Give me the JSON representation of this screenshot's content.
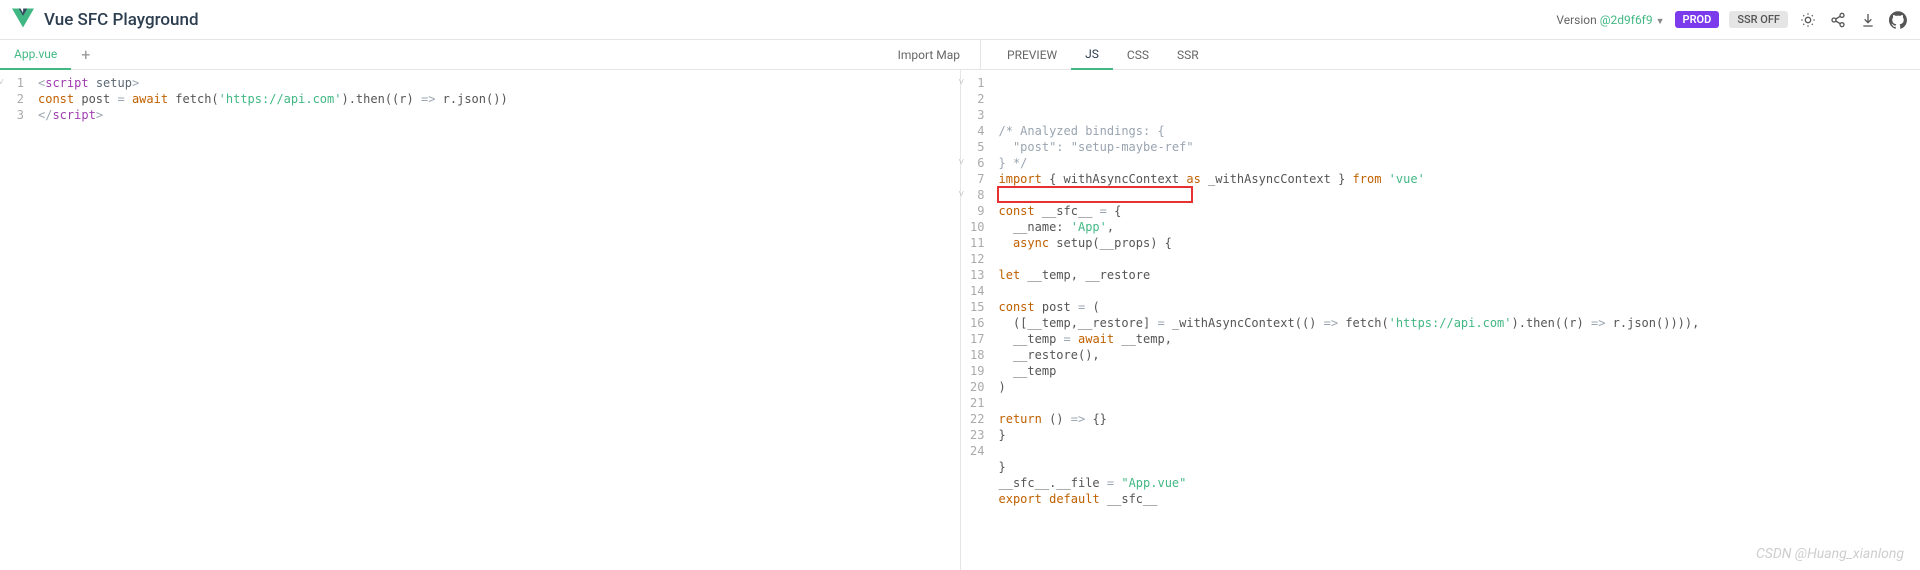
{
  "header": {
    "title": "Vue SFC Playground",
    "version_label": "Version",
    "version_hash": "@2d9f6f9",
    "prod_label": "PROD",
    "ssr_label": "SSR OFF"
  },
  "left_tabs": {
    "file": "App.vue",
    "import_map": "Import Map"
  },
  "right_tabs": {
    "preview": "PREVIEW",
    "js": "JS",
    "css": "CSS",
    "ssr": "SSR",
    "active": "JS"
  },
  "left_code": {
    "lines": [
      {
        "n": 1,
        "fold": true,
        "html": "<span class='op'>&lt;</span><span class='hl'>script</span> <span class='nm'>setup</span><span class='op'>&gt;</span>"
      },
      {
        "n": 2,
        "html": "<span class='kw'>const</span> post <span class='op'>=</span> <span class='kw'>await</span> fetch(<span class='str'>'https://api.com'</span>).then((r) <span class='op'>=&gt;</span> r.json())"
      },
      {
        "n": 3,
        "html": "<span class='op'>&lt;/</span><span class='hl'>script</span><span class='op'>&gt;</span>"
      }
    ]
  },
  "right_code": {
    "highlight_line": 8,
    "lines": [
      {
        "n": 1,
        "fold": true,
        "html": "<span class='cm'>/* Analyzed bindings: {</span>"
      },
      {
        "n": 2,
        "html": "<span class='cm'>  \"post\": \"setup-maybe-ref\"</span>"
      },
      {
        "n": 3,
        "html": "<span class='cm'>} */</span>"
      },
      {
        "n": 4,
        "html": "<span class='kw'>import</span> { withAsyncContext <span class='kw'>as</span> _withAsyncContext } <span class='kw'>from</span> <span class='str'>'vue'</span>"
      },
      {
        "n": 5,
        "html": ""
      },
      {
        "n": 6,
        "fold": true,
        "html": "<span class='kw'>const</span> __sfc__ <span class='op'>=</span> {"
      },
      {
        "n": 7,
        "html": "  __name: <span class='str'>'App'</span>,"
      },
      {
        "n": 8,
        "fold": true,
        "html": "  <span class='kw'>async</span> setup(__props) {"
      },
      {
        "n": 9,
        "html": ""
      },
      {
        "n": 10,
        "html": "<span class='kw'>let</span> __temp, __restore"
      },
      {
        "n": 11,
        "html": ""
      },
      {
        "n": 12,
        "html": "<span class='kw'>const</span> post <span class='op'>=</span> ("
      },
      {
        "n": 13,
        "html": "  ([__temp,__restore] <span class='op'>=</span> _withAsyncContext(() <span class='op'>=&gt;</span> fetch(<span class='str'>'https://api.com'</span>).then((r) <span class='op'>=&gt;</span> r.json()))),"
      },
      {
        "n": 14,
        "html": "  __temp <span class='op'>=</span> <span class='kw'>await</span> __temp,"
      },
      {
        "n": 15,
        "html": "  __restore(),"
      },
      {
        "n": 16,
        "html": "  __temp"
      },
      {
        "n": 17,
        "html": ")"
      },
      {
        "n": 18,
        "html": ""
      },
      {
        "n": 19,
        "html": "<span class='kw'>return</span> () <span class='op'>=&gt;</span> {}"
      },
      {
        "n": 20,
        "html": "}"
      },
      {
        "n": 21,
        "html": ""
      },
      {
        "n": 22,
        "html": "}"
      },
      {
        "n": 23,
        "html": "__sfc__.__file <span class='op'>=</span> <span class='str'>\"App.vue\"</span>"
      },
      {
        "n": 24,
        "html": "<span class='kw'>export</span> <span class='kw'>default</span> __sfc__"
      }
    ]
  },
  "watermark": "CSDN @Huang_xianlong"
}
